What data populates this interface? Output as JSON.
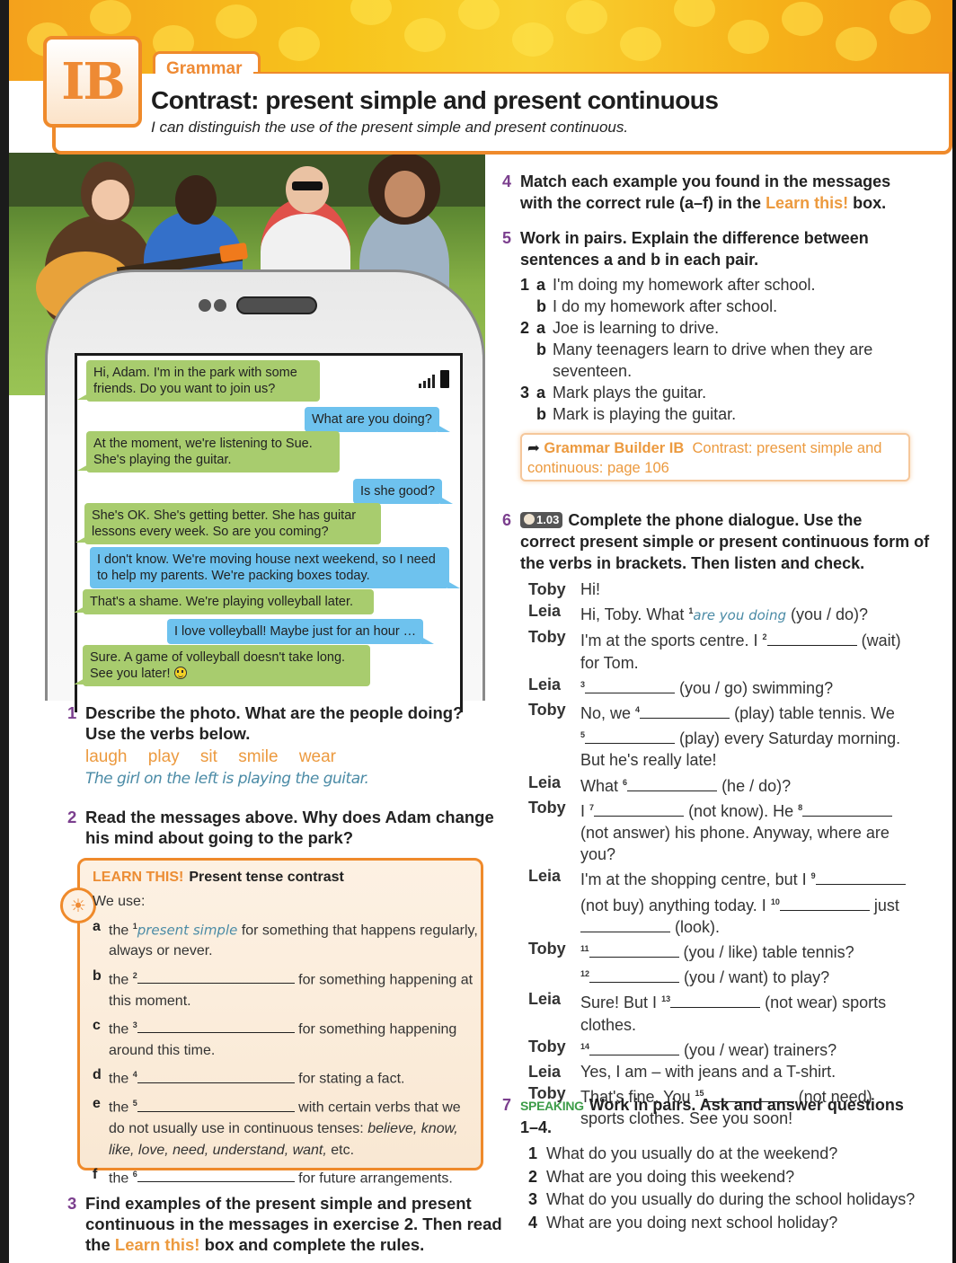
{
  "header": {
    "unit": "IB",
    "section_tab": "Grammar",
    "title": "Contrast: present simple and present continuous",
    "subtitle": "I can distinguish the use of the present simple and present continuous."
  },
  "messages": [
    {
      "from": "friend",
      "color": "green",
      "text": "Hi, Adam. I'm in the park with some friends. Do you want to join us?"
    },
    {
      "from": "adam",
      "color": "blue",
      "text": "What are you doing?"
    },
    {
      "from": "friend",
      "color": "green",
      "text": "At the moment, we're listening to Sue. She's playing the guitar."
    },
    {
      "from": "adam",
      "color": "blue",
      "text": "Is she good?"
    },
    {
      "from": "friend",
      "color": "green",
      "text": "She's OK. She's getting better. She has guitar lessons every week. So are you coming?"
    },
    {
      "from": "adam",
      "color": "blue",
      "text": "I don't know. We're moving house next weekend, so I need to help my parents. We're packing boxes today."
    },
    {
      "from": "friend",
      "color": "green",
      "text": "That's a shame. We're playing volleyball later."
    },
    {
      "from": "adam",
      "color": "blue",
      "text": "I love volleyball! Maybe just for an hour …"
    },
    {
      "from": "friend",
      "color": "green",
      "text": "Sure. A game of volleyball doesn't take long. See you later!"
    }
  ],
  "ex1": {
    "num": "1",
    "line1": "Describe the photo. What are the people doing?",
    "line2": "Use the verbs below.",
    "verbs": [
      "laugh",
      "play",
      "sit",
      "smile",
      "wear"
    ],
    "example": "The girl on the left is playing the guitar."
  },
  "ex2": {
    "num": "2",
    "line1": "Read the messages above. Why does Adam change",
    "line2": "his mind about going to the park?"
  },
  "learn_this": {
    "label": "LEARN THIS!",
    "title": "Present tense contrast",
    "intro": "We use:",
    "rules": [
      {
        "letter": "a",
        "pre": "the",
        "sup": "1",
        "answer": "present simple",
        "text": "for something that happens regularly, always or never."
      },
      {
        "letter": "b",
        "pre": "the",
        "sup": "2",
        "text": "for something happening at this moment."
      },
      {
        "letter": "c",
        "pre": "the",
        "sup": "3",
        "text": "for something happening around this time."
      },
      {
        "letter": "d",
        "pre": "the",
        "sup": "4",
        "text": "for stating a fact."
      },
      {
        "letter": "e",
        "pre": "the",
        "sup": "5",
        "text": "with certain verbs that we do not usually use in continuous tenses:",
        "italic_list": "believe, know, like, love, need, understand, want,",
        "tail": "etc."
      },
      {
        "letter": "f",
        "pre": "the",
        "sup": "6",
        "text": "for future arrangements."
      }
    ]
  },
  "ex3": {
    "num": "3",
    "line1": "Find examples of the present simple and present",
    "line2": "continuous in the messages in exercise 2. Then read",
    "line3_pre": "the",
    "line3_link": "Learn this!",
    "line3_post": "box and complete the rules."
  },
  "ex4": {
    "num": "4",
    "line1": "Match each example you found in the messages",
    "line2_pre": "with the correct rule (a–f) in the",
    "line2_link": "Learn this!",
    "line2_post": "box."
  },
  "ex5": {
    "num": "5",
    "line1": "Work in pairs. Explain the difference between",
    "line2": "sentences a and b in each pair.",
    "pairs": [
      {
        "n": "1",
        "a": "I'm doing my homework after school.",
        "b": "I do my homework after school."
      },
      {
        "n": "2",
        "a": "Joe is learning to drive.",
        "b": "Many teenagers learn to drive when they are",
        "b2": "seventeen."
      },
      {
        "n": "3",
        "a": "Mark plays the guitar.",
        "b": "Mark is playing the guitar."
      }
    ]
  },
  "grammar_builder": {
    "label": "Grammar Builder IB",
    "text1": "Contrast: present simple and",
    "text2": "continuous: page 106"
  },
  "ex6": {
    "num": "6",
    "audio_track": "1.03",
    "line1": "Complete the phone dialogue. Use the",
    "line2": "correct present simple or present continuous form of",
    "line3": "the verbs in brackets. Then listen and check.",
    "dialogue": {
      "l1": {
        "sp": "Toby",
        "text": "Hi!"
      },
      "l2": {
        "sp": "Leia",
        "pre": "Hi, Toby. What",
        "sup": "1",
        "answer": "are you doing",
        "post": "(you / do)?"
      },
      "l3": {
        "sp": "Toby",
        "pre": "I'm at the sports centre. I",
        "sup": "2",
        "post": "(wait)",
        "cont": "for Tom."
      },
      "l4": {
        "sp": "Leia",
        "sup": "3",
        "post": "(you / go) swimming?"
      },
      "l5": {
        "sp": "Toby",
        "pre": "No, we",
        "sup": "4",
        "post": "(play) table tennis. We",
        "sup2": "5",
        "post2": "(play) every Saturday morning.",
        "cont": "But he's really late!"
      },
      "l6": {
        "sp": "Leia",
        "pre": "What",
        "sup": "6",
        "post": "(he / do)?"
      },
      "l7": {
        "sp": "Toby",
        "pre": "I",
        "sup": "7",
        "post": "(not know). He",
        "sup2": "8",
        "cont": "(not answer) his phone. Anyway, where are",
        "cont2": "you?"
      },
      "l8": {
        "sp": "Leia",
        "pre": "I'm at the shopping centre, but I",
        "sup": "9",
        "cont": "(not buy) anything today. I",
        "sup2": "10",
        "post2": "just",
        "cont2": "(look)."
      },
      "l9": {
        "sp": "Toby",
        "sup": "11",
        "post": "(you / like) table tennis?",
        "sup2": "12",
        "post2": "(you / want) to play?"
      },
      "l10": {
        "sp": "Leia",
        "pre": "Sure! But I",
        "sup": "13",
        "post": "(not wear) sports",
        "cont": "clothes."
      },
      "l11": {
        "sp": "Toby",
        "sup": "14",
        "post": "(you / wear) trainers?"
      },
      "l12": {
        "sp": "Leia",
        "text": "Yes, I am – with jeans and a T-shirt."
      },
      "l13": {
        "sp": "Toby",
        "pre": "That's fine. You",
        "sup": "15",
        "post": "(not need)",
        "cont": "sports clothes. See you soon!"
      }
    }
  },
  "ex7": {
    "num": "7",
    "tag": "SPEAKING",
    "line1": "Work in pairs. Ask and answer questions",
    "line2": "1–4.",
    "questions": [
      {
        "n": "1",
        "text": "What do you usually do at the weekend?"
      },
      {
        "n": "2",
        "text": "What are you doing this weekend?"
      },
      {
        "n": "3",
        "text": "What do you usually do during the school holidays?"
      },
      {
        "n": "4",
        "text": "What are you doing next school holiday?"
      }
    ]
  }
}
